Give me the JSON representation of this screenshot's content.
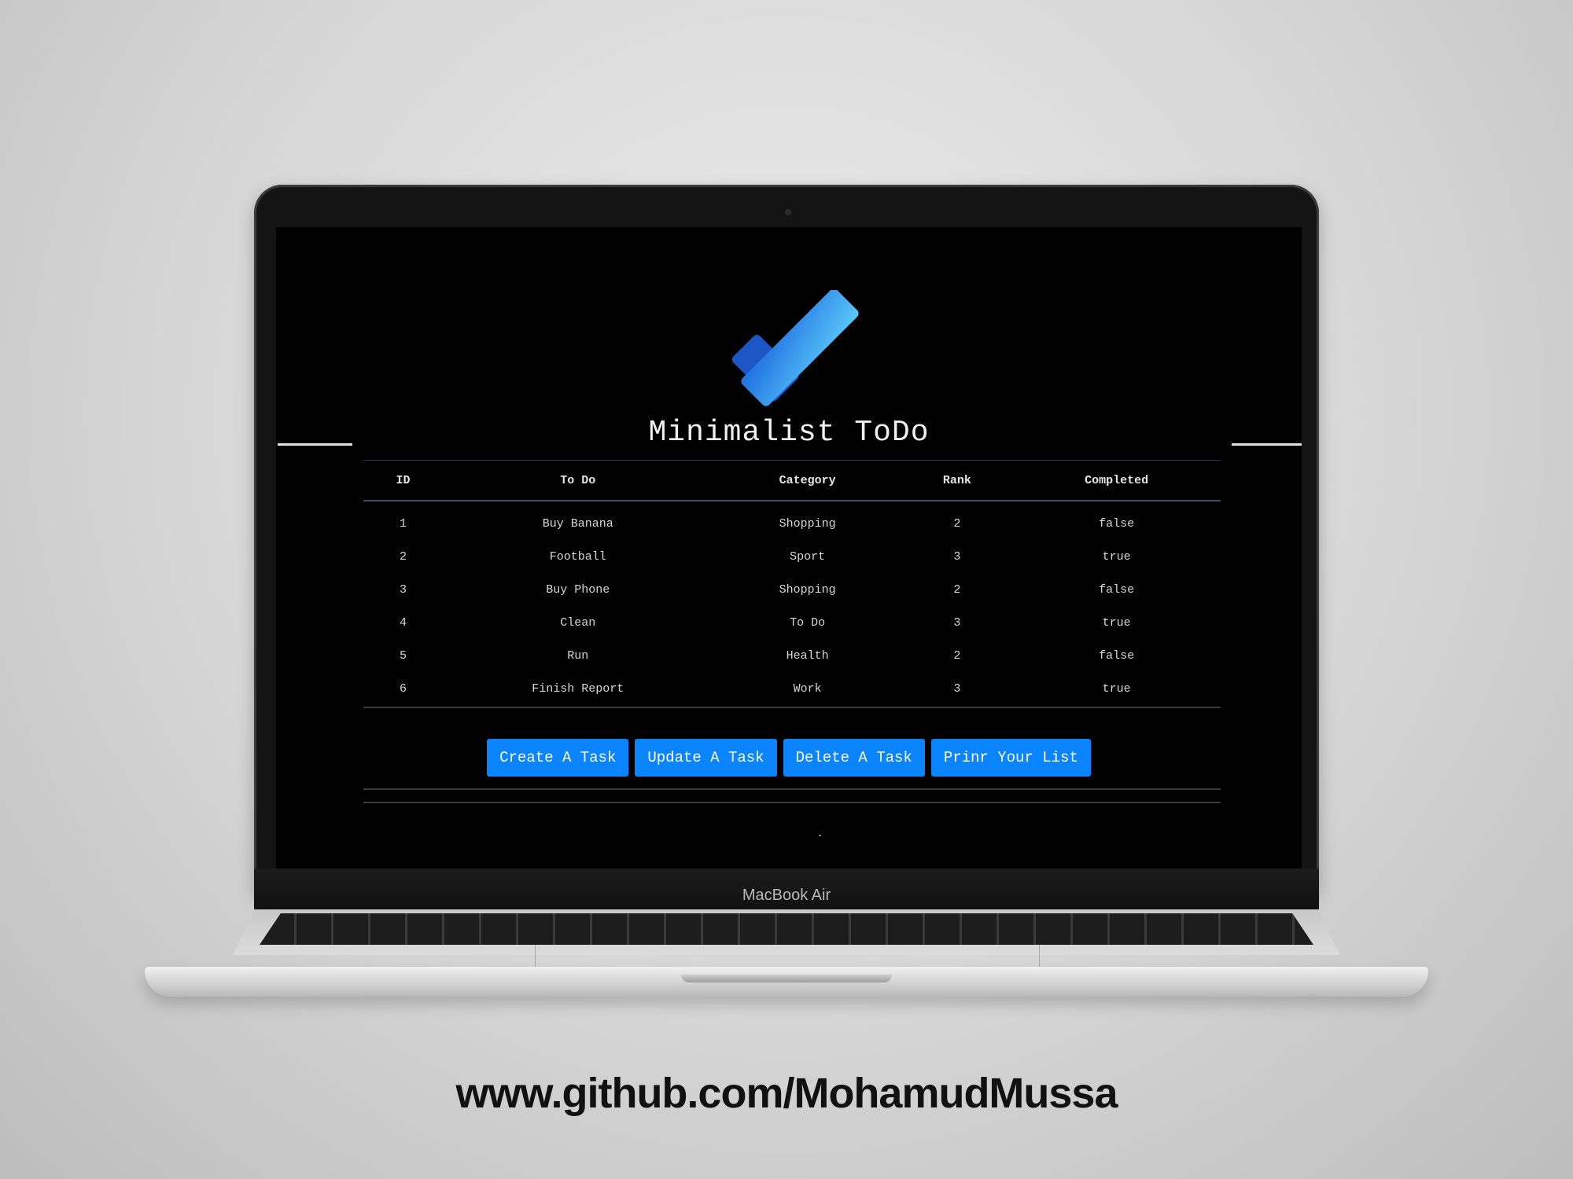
{
  "device": {
    "label": "MacBook Air"
  },
  "app": {
    "title": "Minimalist ToDo",
    "logo_icon": "checkmark-icon",
    "accent_color": "#0a84ff"
  },
  "table": {
    "headers": [
      "ID",
      "To Do",
      "Category",
      "Rank",
      "Completed"
    ],
    "rows": [
      {
        "id": "1",
        "todo": "Buy Banana",
        "category": "Shopping",
        "rank": "2",
        "completed": "false"
      },
      {
        "id": "2",
        "todo": "Football",
        "category": "Sport",
        "rank": "3",
        "completed": "true"
      },
      {
        "id": "3",
        "todo": "Buy Phone",
        "category": "Shopping",
        "rank": "2",
        "completed": "false"
      },
      {
        "id": "4",
        "todo": "Clean",
        "category": "To Do",
        "rank": "3",
        "completed": "true"
      },
      {
        "id": "5",
        "todo": "Run",
        "category": "Health",
        "rank": "2",
        "completed": "false"
      },
      {
        "id": "6",
        "todo": "Finish Report",
        "category": "Work",
        "rank": "3",
        "completed": "true"
      }
    ]
  },
  "actions": {
    "create": "Create A Task",
    "update": "Update A Task",
    "delete": "Delete A Task",
    "print": "Prinr Your List"
  },
  "footer": {
    "link": "www.github.com/MohamudMussa"
  }
}
